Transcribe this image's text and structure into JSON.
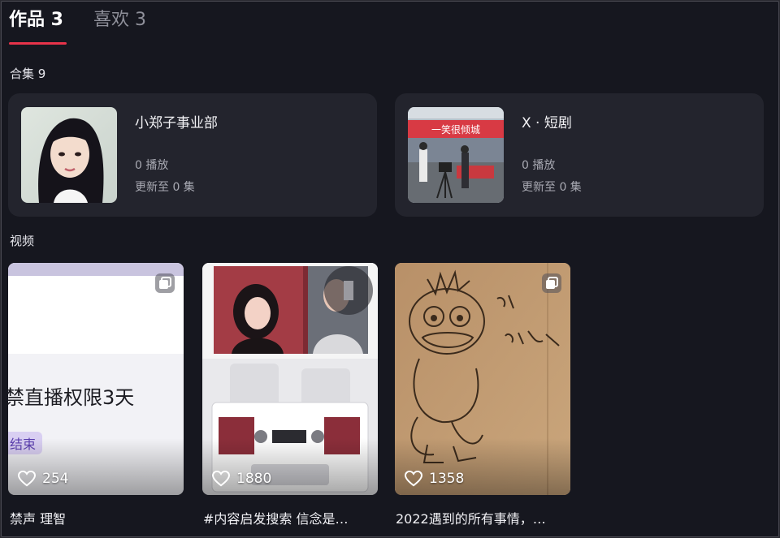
{
  "tabs": [
    {
      "label": "作品 3"
    },
    {
      "label": "喜欢 3"
    }
  ],
  "collections_section": {
    "label": "合集 9"
  },
  "collections": [
    {
      "title": "小郑子事业部",
      "plays": "0 播放",
      "updates": "更新至 0 集"
    },
    {
      "title": "X · 短剧",
      "plays": "0 播放",
      "updates": "更新至 0 集",
      "banner_text": "一笑很倾城"
    }
  ],
  "videos_section": {
    "label": "视频"
  },
  "videos": [
    {
      "title": "禁声 理智",
      "likes": "254",
      "overlay_text": "禁直播权限3天",
      "overlay_tag": "结束"
    },
    {
      "title": "#内容启发搜索 信念是…",
      "likes": "1880"
    },
    {
      "title": "2022遇到的所有事情，…",
      "likes": "1358"
    }
  ],
  "colors": {
    "accent": "#e8334a",
    "background": "#16171f",
    "card": "#23242d"
  }
}
